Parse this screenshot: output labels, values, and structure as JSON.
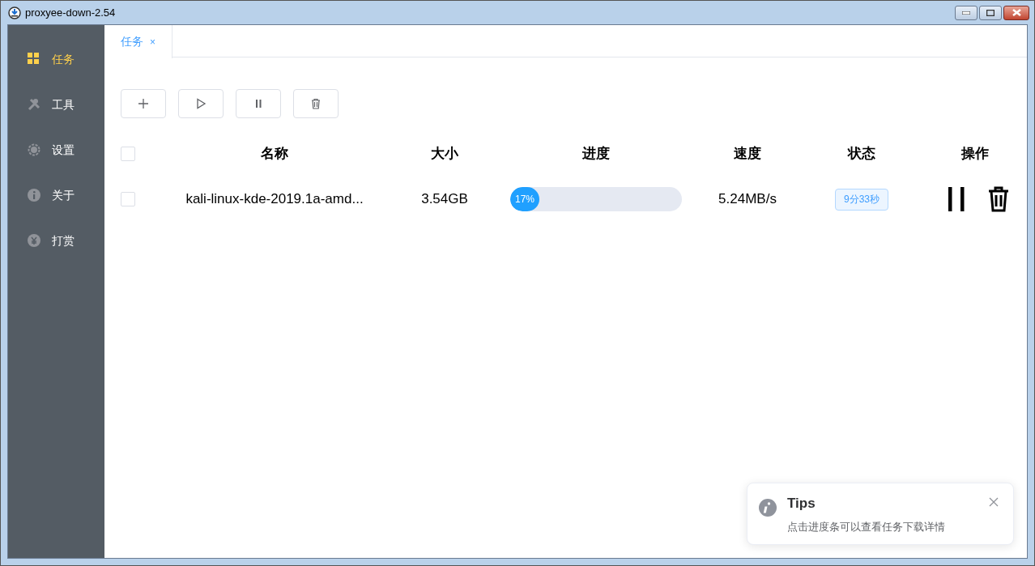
{
  "window": {
    "title": "proxyee-down-2.54"
  },
  "sidebar": {
    "items": [
      {
        "label": "任务",
        "selected": true
      },
      {
        "label": "工具",
        "selected": false
      },
      {
        "label": "设置",
        "selected": false
      },
      {
        "label": "关于",
        "selected": false
      },
      {
        "label": "打赏",
        "selected": false
      }
    ]
  },
  "tabs": [
    {
      "label": "任务",
      "close": "×",
      "selected": true
    }
  ],
  "table": {
    "columns": [
      "名称",
      "大小",
      "进度",
      "速度",
      "状态",
      "操作"
    ],
    "all_checked": false,
    "rows": [
      {
        "checked": false,
        "name": "kali-linux-kde-2019.1a-amd...",
        "size": "3.54GB",
        "level": 0.17,
        "progress": "17%",
        "speed": "5.24MB/s",
        "status": "9分33秒"
      }
    ]
  },
  "notification": {
    "title": "Tips",
    "message": "点击进度条可以查看任务下载详情"
  }
}
